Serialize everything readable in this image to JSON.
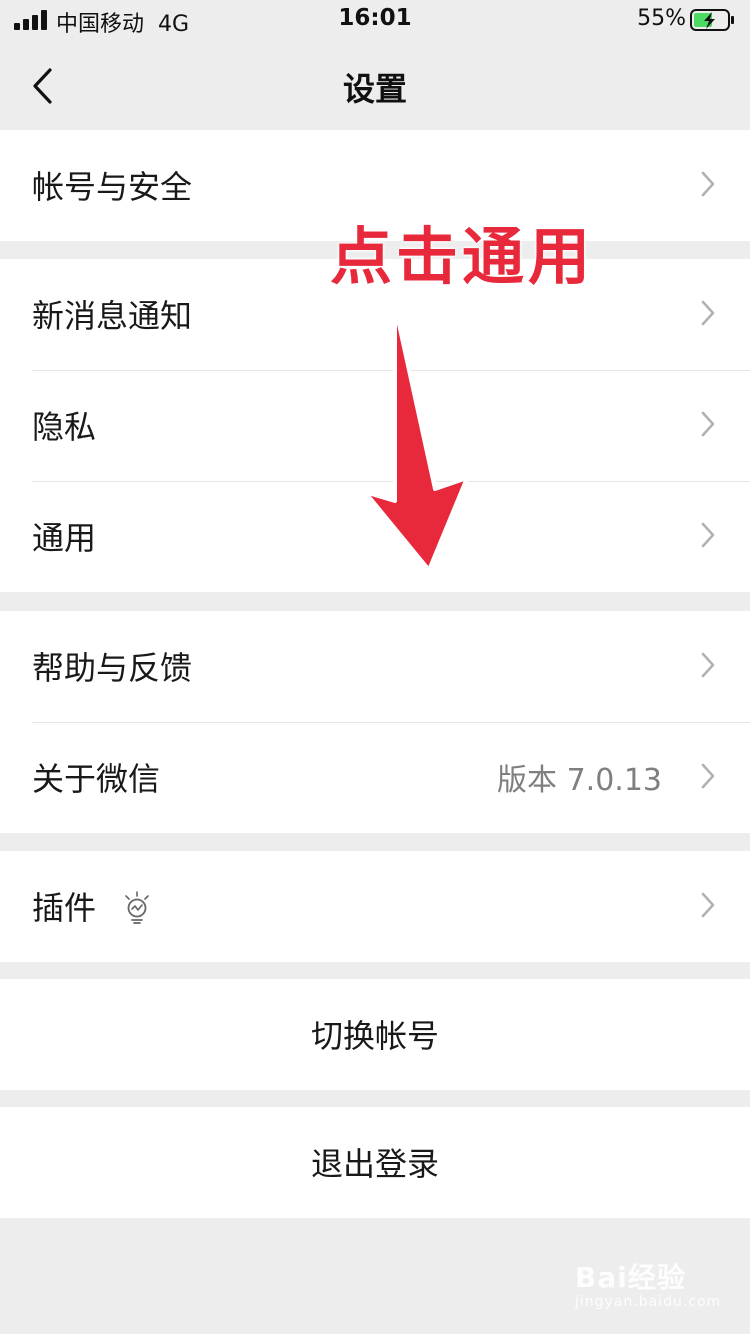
{
  "status_bar": {
    "carrier": "中国移动",
    "network": "4G",
    "time": "16:01",
    "battery_percent": "55%",
    "battery_level": 0.55
  },
  "nav": {
    "title": "设置",
    "back_icon": "chevron-left-icon"
  },
  "groups": [
    {
      "items": [
        {
          "label": "帐号与安全"
        }
      ]
    },
    {
      "items": [
        {
          "label": "新消息通知"
        },
        {
          "label": "隐私"
        },
        {
          "label": "通用"
        }
      ]
    },
    {
      "items": [
        {
          "label": "帮助与反馈"
        },
        {
          "label": "关于微信",
          "value": "版本 7.0.13"
        }
      ]
    },
    {
      "items": [
        {
          "label": "插件",
          "icon": "lightbulb-icon"
        }
      ]
    }
  ],
  "actions": {
    "switch_account": "切换帐号",
    "logout": "退出登录"
  },
  "annotation": {
    "text": "点击通用",
    "color": "#e8293b"
  },
  "watermark": {
    "main": "Bai经验",
    "sub": "jingyan.baidu.com"
  }
}
